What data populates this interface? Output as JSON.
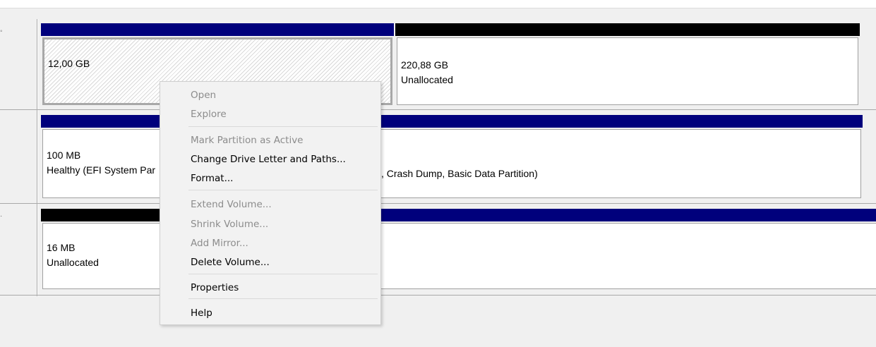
{
  "disks": [
    {
      "partitions": [
        {
          "size": "12,00 GB",
          "status": ""
        },
        {
          "size": "220,88 GB",
          "status": "Unallocated"
        }
      ]
    },
    {
      "partitions": [
        {
          "size": "100 MB",
          "status": "Healthy (EFI System Par"
        },
        {
          "size": "",
          "status": ", Crash Dump, Basic Data Partition)"
        }
      ]
    },
    {
      "partitions": [
        {
          "size": "16 MB",
          "status": "Unallocated"
        }
      ]
    }
  ],
  "context_menu": {
    "items": [
      {
        "label": "Open",
        "enabled": false
      },
      {
        "label": "Explore",
        "enabled": false
      },
      {
        "label": "Mark Partition as Active",
        "enabled": false
      },
      {
        "label": "Change Drive Letter and Paths...",
        "enabled": true
      },
      {
        "label": "Format...",
        "enabled": true
      },
      {
        "label": "Extend Volume...",
        "enabled": false
      },
      {
        "label": "Shrink Volume...",
        "enabled": false
      },
      {
        "label": "Add Mirror...",
        "enabled": false
      },
      {
        "label": "Delete Volume...",
        "enabled": true
      },
      {
        "label": "Properties",
        "enabled": true
      },
      {
        "label": "Help",
        "enabled": true
      }
    ]
  },
  "colors": {
    "primary_partition_bar": "#00007c",
    "unallocated_bar": "#000000",
    "window_background": "#f0f0f0"
  }
}
